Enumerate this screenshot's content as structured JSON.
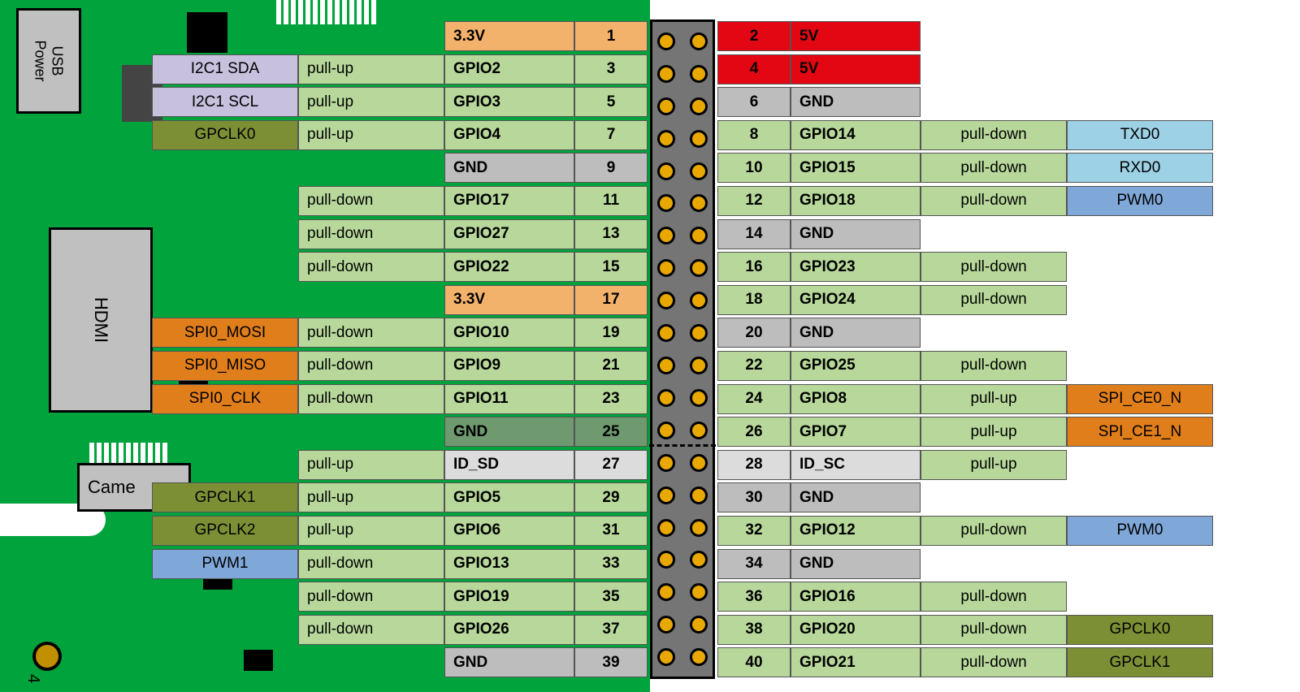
{
  "board": {
    "ports": {
      "usb": "USB\nPower",
      "hdmi": "HDMI",
      "camera": "Came"
    },
    "corner_number": "4"
  },
  "pins_left": [
    {
      "num": "1",
      "name": "3.3V",
      "nc": "c-orange",
      "pull": null,
      "alt": null
    },
    {
      "num": "3",
      "name": "GPIO2",
      "nc": "c-green",
      "pull": "pull-up",
      "alt": "I2C1 SDA",
      "ac": "c-lilac"
    },
    {
      "num": "5",
      "name": "GPIO3",
      "nc": "c-green",
      "pull": "pull-up",
      "alt": "I2C1 SCL",
      "ac": "c-lilac"
    },
    {
      "num": "7",
      "name": "GPIO4",
      "nc": "c-green",
      "pull": "pull-up",
      "alt": "GPCLK0",
      "ac": "c-olive"
    },
    {
      "num": "9",
      "name": "GND",
      "nc": "c-gray",
      "pull": null,
      "alt": null
    },
    {
      "num": "11",
      "name": "GPIO17",
      "nc": "c-green",
      "pull": "pull-down",
      "alt": null
    },
    {
      "num": "13",
      "name": "GPIO27",
      "nc": "c-green",
      "pull": "pull-down",
      "alt": null
    },
    {
      "num": "15",
      "name": "GPIO22",
      "nc": "c-green",
      "pull": "pull-down",
      "alt": null
    },
    {
      "num": "17",
      "name": "3.3V",
      "nc": "c-orange",
      "pull": null,
      "alt": null
    },
    {
      "num": "19",
      "name": "GPIO10",
      "nc": "c-green",
      "pull": "pull-down",
      "alt": "SPI0_MOSI",
      "ac": "c-dorange"
    },
    {
      "num": "21",
      "name": "GPIO9",
      "nc": "c-green",
      "pull": "pull-down",
      "alt": "SPI0_MISO",
      "ac": "c-dorange"
    },
    {
      "num": "23",
      "name": "GPIO11",
      "nc": "c-green",
      "pull": "pull-down",
      "alt": "SPI0_CLK",
      "ac": "c-dorange"
    },
    {
      "num": "25",
      "name": "GND",
      "nc": "c-dgreen",
      "pull": null,
      "alt": null
    },
    {
      "num": "27",
      "name": "ID_SD",
      "nc": "c-lgray",
      "pull": "pull-up",
      "alt": null
    },
    {
      "num": "29",
      "name": "GPIO5",
      "nc": "c-green",
      "pull": "pull-up",
      "alt": "GPCLK1",
      "ac": "c-olive"
    },
    {
      "num": "31",
      "name": "GPIO6",
      "nc": "c-green",
      "pull": "pull-up",
      "alt": "GPCLK2",
      "ac": "c-olive"
    },
    {
      "num": "33",
      "name": "GPIO13",
      "nc": "c-green",
      "pull": "pull-down",
      "alt": "PWM1",
      "ac": "c-blue"
    },
    {
      "num": "35",
      "name": "GPIO19",
      "nc": "c-green",
      "pull": "pull-down",
      "alt": null
    },
    {
      "num": "37",
      "name": "GPIO26",
      "nc": "c-green",
      "pull": "pull-down",
      "alt": null
    },
    {
      "num": "39",
      "name": "GND",
      "nc": "c-gray",
      "pull": null,
      "alt": null
    }
  ],
  "pins_right": [
    {
      "num": "2",
      "name": "5V",
      "nc": "c-red",
      "pull": null,
      "alt": null
    },
    {
      "num": "4",
      "name": "5V",
      "nc": "c-red",
      "pull": null,
      "alt": null
    },
    {
      "num": "6",
      "name": "GND",
      "nc": "c-gray",
      "pull": null,
      "alt": null
    },
    {
      "num": "8",
      "name": "GPIO14",
      "nc": "c-green",
      "pull": "pull-down",
      "alt": "TXD0",
      "ac": "c-sky"
    },
    {
      "num": "10",
      "name": "GPIO15",
      "nc": "c-green",
      "pull": "pull-down",
      "alt": "RXD0",
      "ac": "c-sky"
    },
    {
      "num": "12",
      "name": "GPIO18",
      "nc": "c-green",
      "pull": "pull-down",
      "alt": "PWM0",
      "ac": "c-blue"
    },
    {
      "num": "14",
      "name": "GND",
      "nc": "c-gray",
      "pull": null,
      "alt": null
    },
    {
      "num": "16",
      "name": "GPIO23",
      "nc": "c-green",
      "pull": "pull-down",
      "alt": null
    },
    {
      "num": "18",
      "name": "GPIO24",
      "nc": "c-green",
      "pull": "pull-down",
      "alt": null
    },
    {
      "num": "20",
      "name": "GND",
      "nc": "c-gray",
      "pull": null,
      "alt": null
    },
    {
      "num": "22",
      "name": "GPIO25",
      "nc": "c-green",
      "pull": "pull-down",
      "alt": null
    },
    {
      "num": "24",
      "name": "GPIO8",
      "nc": "c-green",
      "pull": "pull-up",
      "alt": "SPI_CE0_N",
      "ac": "c-dorange"
    },
    {
      "num": "26",
      "name": "GPIO7",
      "nc": "c-green",
      "pull": "pull-up",
      "alt": "SPI_CE1_N",
      "ac": "c-dorange"
    },
    {
      "num": "28",
      "name": "ID_SC",
      "nc": "c-lgray",
      "pull": "pull-up",
      "alt": null
    },
    {
      "num": "30",
      "name": "GND",
      "nc": "c-gray",
      "pull": null,
      "alt": null
    },
    {
      "num": "32",
      "name": "GPIO12",
      "nc": "c-green",
      "pull": "pull-down",
      "alt": "PWM0",
      "ac": "c-blue"
    },
    {
      "num": "34",
      "name": "GND",
      "nc": "c-gray",
      "pull": null,
      "alt": null
    },
    {
      "num": "36",
      "name": "GPIO16",
      "nc": "c-green",
      "pull": "pull-down",
      "alt": null
    },
    {
      "num": "38",
      "name": "GPIO20",
      "nc": "c-green",
      "pull": "pull-down",
      "alt": "GPCLK0",
      "ac": "c-olive"
    },
    {
      "num": "40",
      "name": "GPIO21",
      "nc": "c-green",
      "pull": "pull-down",
      "alt": "GPCLK1",
      "ac": "c-olive"
    }
  ]
}
